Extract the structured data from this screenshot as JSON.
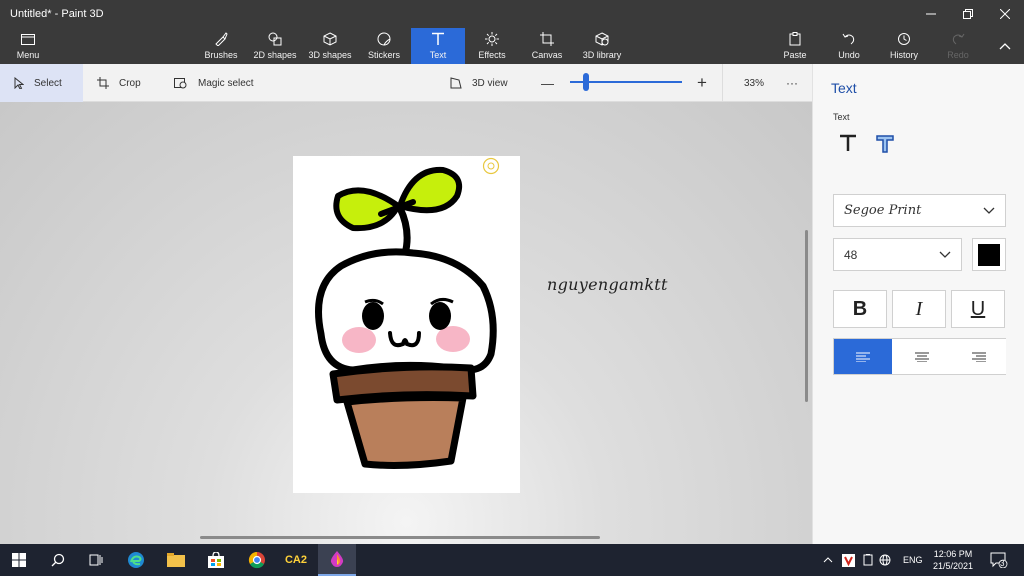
{
  "window": {
    "title": "Untitled* - Paint 3D",
    "controls": [
      "minimize",
      "maximize",
      "close"
    ]
  },
  "ribbon": {
    "menu": "Menu",
    "tools": [
      {
        "label": "Brushes",
        "icon": "brush-icon"
      },
      {
        "label": "2D shapes",
        "icon": "2d-shapes-icon"
      },
      {
        "label": "3D shapes",
        "icon": "3d-shapes-icon"
      },
      {
        "label": "Stickers",
        "icon": "stickers-icon"
      },
      {
        "label": "Text",
        "icon": "text-icon",
        "active": true
      },
      {
        "label": "Effects",
        "icon": "effects-icon"
      },
      {
        "label": "Canvas",
        "icon": "canvas-icon"
      },
      {
        "label": "3D library",
        "icon": "3d-library-icon"
      }
    ],
    "right": [
      {
        "label": "Paste",
        "icon": "paste-icon"
      },
      {
        "label": "Undo",
        "icon": "undo-icon"
      },
      {
        "label": "History",
        "icon": "history-icon"
      },
      {
        "label": "Redo",
        "icon": "redo-icon",
        "disabled": true
      }
    ]
  },
  "toolbar": {
    "select": "Select",
    "crop": "Crop",
    "magic_select": "Magic select",
    "view_3d": "3D view",
    "zoom_minus": "—",
    "zoom_plus": "+",
    "zoom_value": "33%",
    "more": "···"
  },
  "canvas": {
    "text_object": "nguyengamktt"
  },
  "panel": {
    "title": "Text",
    "section_label": "Text",
    "font": "Segoe Print",
    "size": "48",
    "color": "#000000",
    "bold": "B",
    "italic": "I",
    "underline": "U"
  },
  "taskbar": {
    "pinned": [
      "windows-start-icon",
      "search-icon",
      "task-view-icon",
      "edge-icon",
      "file-explorer-icon",
      "store-icon",
      "chrome-icon",
      "ca2-app-icon",
      "paint-3d-icon"
    ],
    "ca2_label": "CA2",
    "language": "ENG",
    "time": "12:06 PM",
    "date": "21/5/2021",
    "notifications": "3"
  },
  "colors": {
    "accent": "#2b6ad8",
    "title_bar": "#3a3a3a",
    "taskbar": "#1e2330"
  }
}
